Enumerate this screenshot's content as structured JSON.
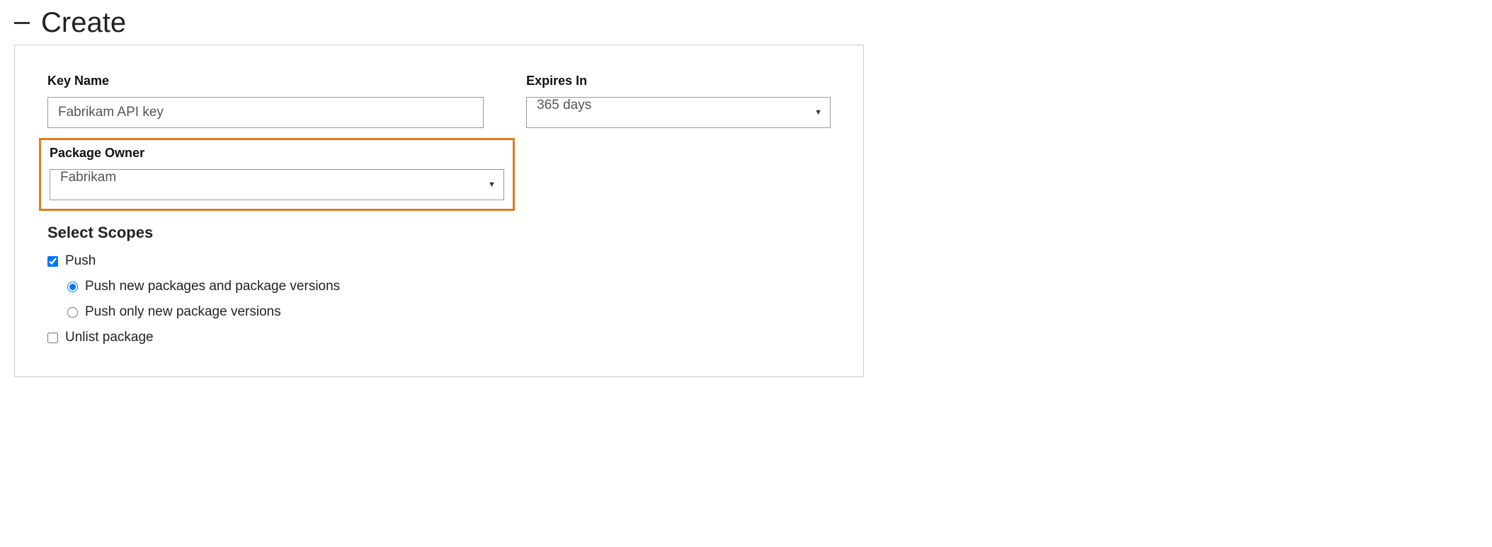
{
  "section": {
    "title": "Create"
  },
  "form": {
    "keyName": {
      "label": "Key Name",
      "value": "Fabrikam API key"
    },
    "expiresIn": {
      "label": "Expires In",
      "value": "365 days"
    },
    "packageOwner": {
      "label": "Package Owner",
      "value": "Fabrikam"
    },
    "scopes": {
      "title": "Select Scopes",
      "push": {
        "label": "Push",
        "checked": true,
        "options": {
          "newPackagesAndVersions": {
            "label": "Push new packages and package versions",
            "selected": true
          },
          "onlyNewVersions": {
            "label": "Push only new package versions",
            "selected": false
          }
        }
      },
      "unlist": {
        "label": "Unlist package",
        "checked": false
      }
    }
  }
}
